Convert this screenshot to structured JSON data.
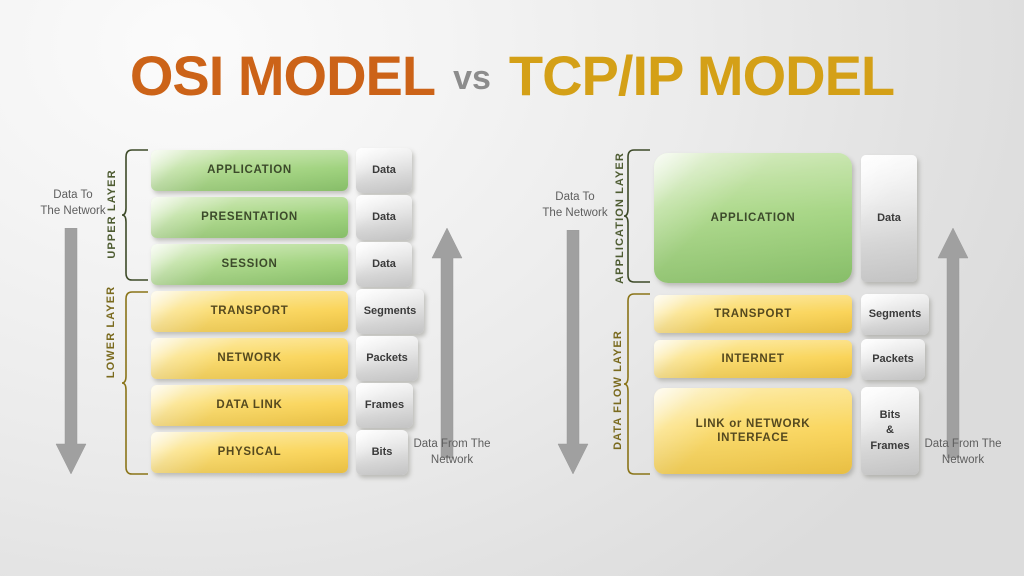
{
  "title": {
    "left": "OSI MODEL",
    "middle": "vs",
    "right": "TCP/IP MODEL",
    "left_color": "#cc6318",
    "middle_color": "#8c8c8c",
    "right_color": "#d4a017"
  },
  "colors": {
    "background": "#ebebeb",
    "green_layer": "#a9d787",
    "yellow_layer": "#fad45a",
    "gray_unit": "#e2e2e2",
    "green_brace": "#3d4a28",
    "yellow_brace": "#8a7418",
    "arrow": "#9e9e9e",
    "text": "#5e5e5e"
  },
  "osi": {
    "flow_down_label": "Data To\nThe Network",
    "flow_up_label": "Data From The\nNetwork",
    "groups": [
      {
        "name": "UPPER LAYER",
        "color": "#3d4a28"
      },
      {
        "name": "LOWER LAYER",
        "color": "#8a7418"
      }
    ],
    "layers": [
      {
        "name": "APPLICATION",
        "unit": "Data",
        "group": "upper",
        "style": "green"
      },
      {
        "name": "PRESENTATION",
        "unit": "Data",
        "group": "upper",
        "style": "green"
      },
      {
        "name": "SESSION",
        "unit": "Data",
        "group": "upper",
        "style": "green"
      },
      {
        "name": "TRANSPORT",
        "unit": "Segments",
        "group": "lower",
        "style": "yellow"
      },
      {
        "name": "NETWORK",
        "unit": "Packets",
        "group": "lower",
        "style": "yellow"
      },
      {
        "name": "DATA LINK",
        "unit": "Frames",
        "group": "lower",
        "style": "yellow"
      },
      {
        "name": "PHYSICAL",
        "unit": "Bits",
        "group": "lower",
        "style": "yellow"
      }
    ]
  },
  "tcpip": {
    "flow_down_label": "Data To\nThe Network",
    "flow_up_label": "Data From The\nNetwork",
    "groups": [
      {
        "name": "APPLICATION LAYER",
        "color": "#3d4a28"
      },
      {
        "name": "DATA FLOW LAYER",
        "color": "#8a7418"
      }
    ],
    "layers": [
      {
        "name": "APPLICATION",
        "unit": "Data",
        "group": "application",
        "style": "green"
      },
      {
        "name": "TRANSPORT",
        "unit": "Segments",
        "group": "dataflow",
        "style": "yellow"
      },
      {
        "name": "INTERNET",
        "unit": "Packets",
        "group": "dataflow",
        "style": "yellow"
      },
      {
        "name": "LINK or NETWORK\nINTERFACE",
        "unit": "Bits\n&\nFrames",
        "group": "dataflow",
        "style": "yellow"
      }
    ]
  }
}
